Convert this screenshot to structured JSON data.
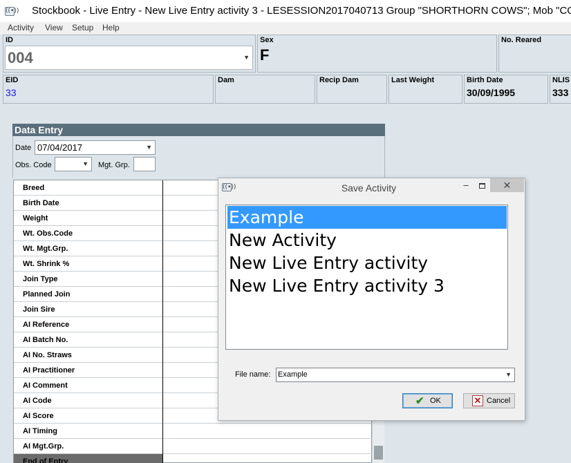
{
  "window": {
    "title": "Stockbook - Live Entry - New Live Entry activity 3 - LESESSION2017040713 Group \"SHORTHORN COWS\"; Mob \"COWS\"",
    "menu": [
      "Activity",
      "View",
      "Setup",
      "Help"
    ]
  },
  "animal": {
    "id_label": "ID",
    "id_value": "004",
    "sex_label": "Sex",
    "sex_value": "F",
    "no_reared_label": "No. Reared",
    "eid_label": "EID",
    "eid_value": "33",
    "dam_label": "Dam",
    "recip_dam_label": "Recip Dam",
    "last_weight_label": "Last Weight",
    "birth_date_label": "Birth Date",
    "birth_date_value": "30/09/1995",
    "nlis_label": "NLIS I",
    "nlis_value": "333"
  },
  "data_entry": {
    "header": "Data Entry",
    "date_label": "Date",
    "date_value": "07/04/2017",
    "obs_code_label": "Obs. Code",
    "mgt_grp_label": "Mgt. Grp.",
    "fields": [
      "Breed",
      "Birth Date",
      "Weight",
      "Wt. Obs.Code",
      "Wt. Mgt.Grp.",
      "Wt. Shrink %",
      "Join Type",
      "Planned Join",
      "Join Sire",
      "AI Reference",
      "AI Batch No.",
      "AI No. Straws",
      "AI Practitioner",
      "AI Comment",
      "AI Code",
      "AI Score",
      "AI Timing",
      "AI Mgt.Grp."
    ],
    "end_row": "End of Entry"
  },
  "dialog": {
    "title": "Save Activity",
    "min_glyph": "–",
    "close_glyph": "✕",
    "items": [
      "Example",
      "New Activity",
      "New Live Entry activity",
      "New Live Entry activity 3"
    ],
    "selected_index": 0,
    "file_name_label": "File name:",
    "file_name_value": "Example",
    "ok_label": "OK",
    "cancel_label": "Cancel"
  },
  "colors": {
    "selection": "#3399ff",
    "eid_text": "#1a1ad6",
    "panel_bg": "#dde5ea",
    "header_bg": "#5a6f7c"
  },
  "icons": {
    "app": "app-antenna-icon",
    "dropdown": "chevron-down-icon",
    "ok": "check-icon",
    "cancel": "x-icon"
  }
}
